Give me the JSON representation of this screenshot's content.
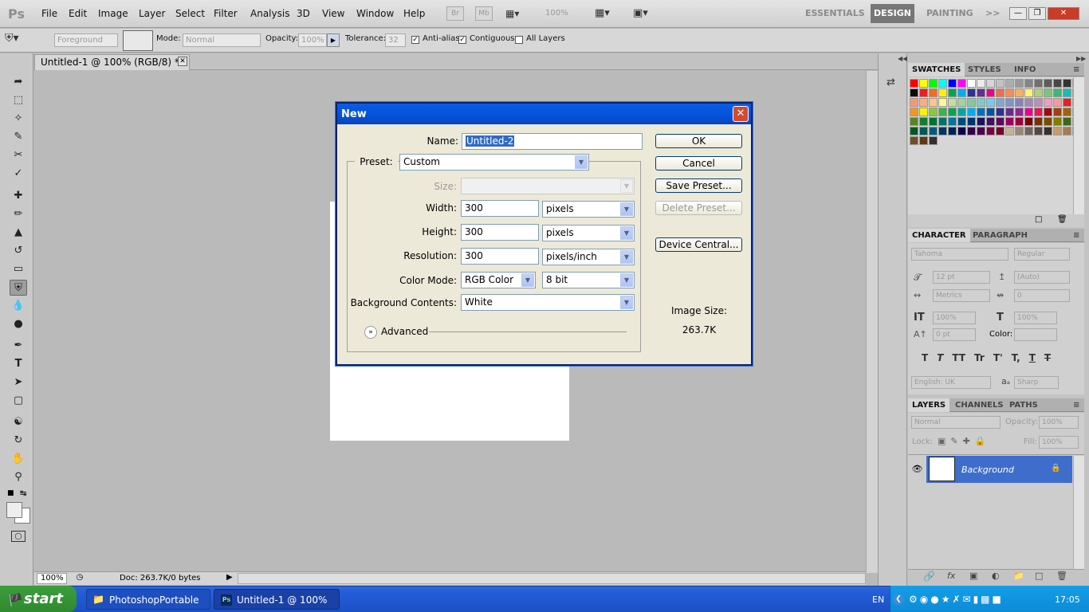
{
  "app": {
    "logo": "Ps",
    "menu": [
      "File",
      "Edit",
      "Image",
      "Layer",
      "Select",
      "Filter",
      "Analysis",
      "3D",
      "View",
      "Window",
      "Help"
    ],
    "appbar": {
      "br": "Br",
      "mb": "Mb",
      "zoom": "100%"
    },
    "workspaces": {
      "essentials": "ESSENTIALS",
      "design": "DESIGN",
      "painting": "PAINTING",
      "more": ">>"
    }
  },
  "options": {
    "fill_source": "Foreground",
    "mode_label": "Mode:",
    "mode_value": "Normal",
    "opacity_label": "Opacity:",
    "opacity_value": "100%",
    "tolerance_label": "Tolerance:",
    "tolerance_value": "32",
    "antialias_label": "Anti-alias",
    "contiguous_label": "Contiguous",
    "alllayers_label": "All Layers",
    "antialias_checked": true,
    "contiguous_checked": true,
    "alllayers_checked": false
  },
  "document": {
    "tab_title": "Untitled-1 @ 100% (RGB/8) *",
    "zoom": "100%",
    "doc_info": "Doc: 263.7K/0 bytes"
  },
  "dialog": {
    "title": "New",
    "name_label": "Name:",
    "name_value": "Untitled-2",
    "preset_label": "Preset:",
    "preset_value": "Custom",
    "size_label": "Size:",
    "width_label": "Width:",
    "width_value": "300",
    "width_unit": "pixels",
    "height_label": "Height:",
    "height_value": "300",
    "height_unit": "pixels",
    "resolution_label": "Resolution:",
    "resolution_value": "300",
    "resolution_unit": "pixels/inch",
    "colormode_label": "Color Mode:",
    "colormode_value": "RGB Color",
    "bitdepth_value": "8 bit",
    "bg_label": "Background Contents:",
    "bg_value": "White",
    "advanced_label": "Advanced",
    "ok": "OK",
    "cancel": "Cancel",
    "save_preset": "Save Preset...",
    "delete_preset": "Delete Preset...",
    "device_central": "Device Central...",
    "image_size_label": "Image Size:",
    "image_size_value": "263.7K"
  },
  "panels": {
    "swatches_tabs": [
      "SWATCHES",
      "STYLES",
      "INFO"
    ],
    "character_tabs": [
      "CHARACTER",
      "PARAGRAPH"
    ],
    "character": {
      "font": "Tahoma",
      "style": "Regular",
      "size": "12 pt",
      "leading": "(Auto)",
      "kerning": "Metrics",
      "tracking": "0",
      "vscale": "100%",
      "hscale": "100%",
      "baseline": "0 pt",
      "color_label": "Color:",
      "language": "English: UK",
      "aa_label": "aₐ",
      "antialias": "Sharp",
      "style_buttons": [
        "T",
        "T",
        "TT",
        "Tr",
        "T'",
        "T,",
        "T",
        "T"
      ]
    },
    "layers_tabs": [
      "LAYERS",
      "CHANNELS",
      "PATHS"
    ],
    "layers": {
      "blend": "Normal",
      "opacity_label": "Opacity:",
      "opacity": "100%",
      "lock_label": "Lock:",
      "fill_label": "Fill:",
      "fill": "100%",
      "layer_name": "Background"
    }
  },
  "swatch_colors": [
    [
      "#ff0000",
      "#ffff00",
      "#00ff00",
      "#00ffff",
      "#0000ff",
      "#ff00ff",
      "#ffffff",
      "#ebebeb",
      "#d6d6d6",
      "#c2c2c2",
      "#adadad",
      "#999999",
      "#858585",
      "#707070",
      "#5c5c5c",
      "#474747",
      "#333333",
      "#1f1f1f"
    ],
    [
      "#0a0a0a",
      "#ee1d24",
      "#f36c21",
      "#fff200",
      "#00a651",
      "#00aeef",
      "#2e3192",
      "#662d91",
      "#ec008c",
      "#f26c4f",
      "#f68e56",
      "#fbaf5d",
      "#fff568",
      "#acd373",
      "#7cc576",
      "#3bb878",
      "#1abbb4",
      "#00bff3"
    ],
    [
      "#f7977a",
      "#f9ad81",
      "#fdc68a",
      "#fff79a",
      "#c4df9b",
      "#a3d39c",
      "#82ca9d",
      "#7bcdc8",
      "#6ecff6",
      "#7ea7d8",
      "#8493ca",
      "#8882be",
      "#a187be",
      "#bc8dbf",
      "#f49ac2",
      "#f6989d",
      "#ed1c24",
      "#f26522"
    ],
    [
      "#f7941d",
      "#fff200",
      "#8dc63f",
      "#39b54a",
      "#00a651",
      "#00a99d",
      "#00aeef",
      "#0072bc",
      "#0054a6",
      "#2e3192",
      "#662d91",
      "#92278f",
      "#ec008c",
      "#ed145b",
      "#9e0b0f",
      "#a0410d",
      "#a36209",
      "#aba000"
    ],
    [
      "#598527",
      "#197b30",
      "#007236",
      "#00746b",
      "#0076a3",
      "#004b80",
      "#003471",
      "#1b1464",
      "#440e62",
      "#630460",
      "#9e005d",
      "#9e0039",
      "#790000",
      "#7b2e00",
      "#7d4900",
      "#827b00",
      "#406618",
      "#005e20"
    ],
    [
      "#005826",
      "#005952",
      "#005b7f",
      "#003663",
      "#002157",
      "#0d004c",
      "#32004b",
      "#4b0049",
      "#7b0046",
      "#7a0026",
      "#c7b299",
      "#998675",
      "#736357",
      "#534741",
      "#37302d",
      "#c69c6d",
      "#a67c52",
      "#8c6239"
    ],
    [
      "#754c24",
      "#603913",
      "#362f2d"
    ]
  ],
  "taskbar": {
    "start": "start",
    "folder": "PhotoshopPortable",
    "ps_window": "Untitled-1 @ 100% (...",
    "lang": "EN",
    "time": "17:05"
  }
}
